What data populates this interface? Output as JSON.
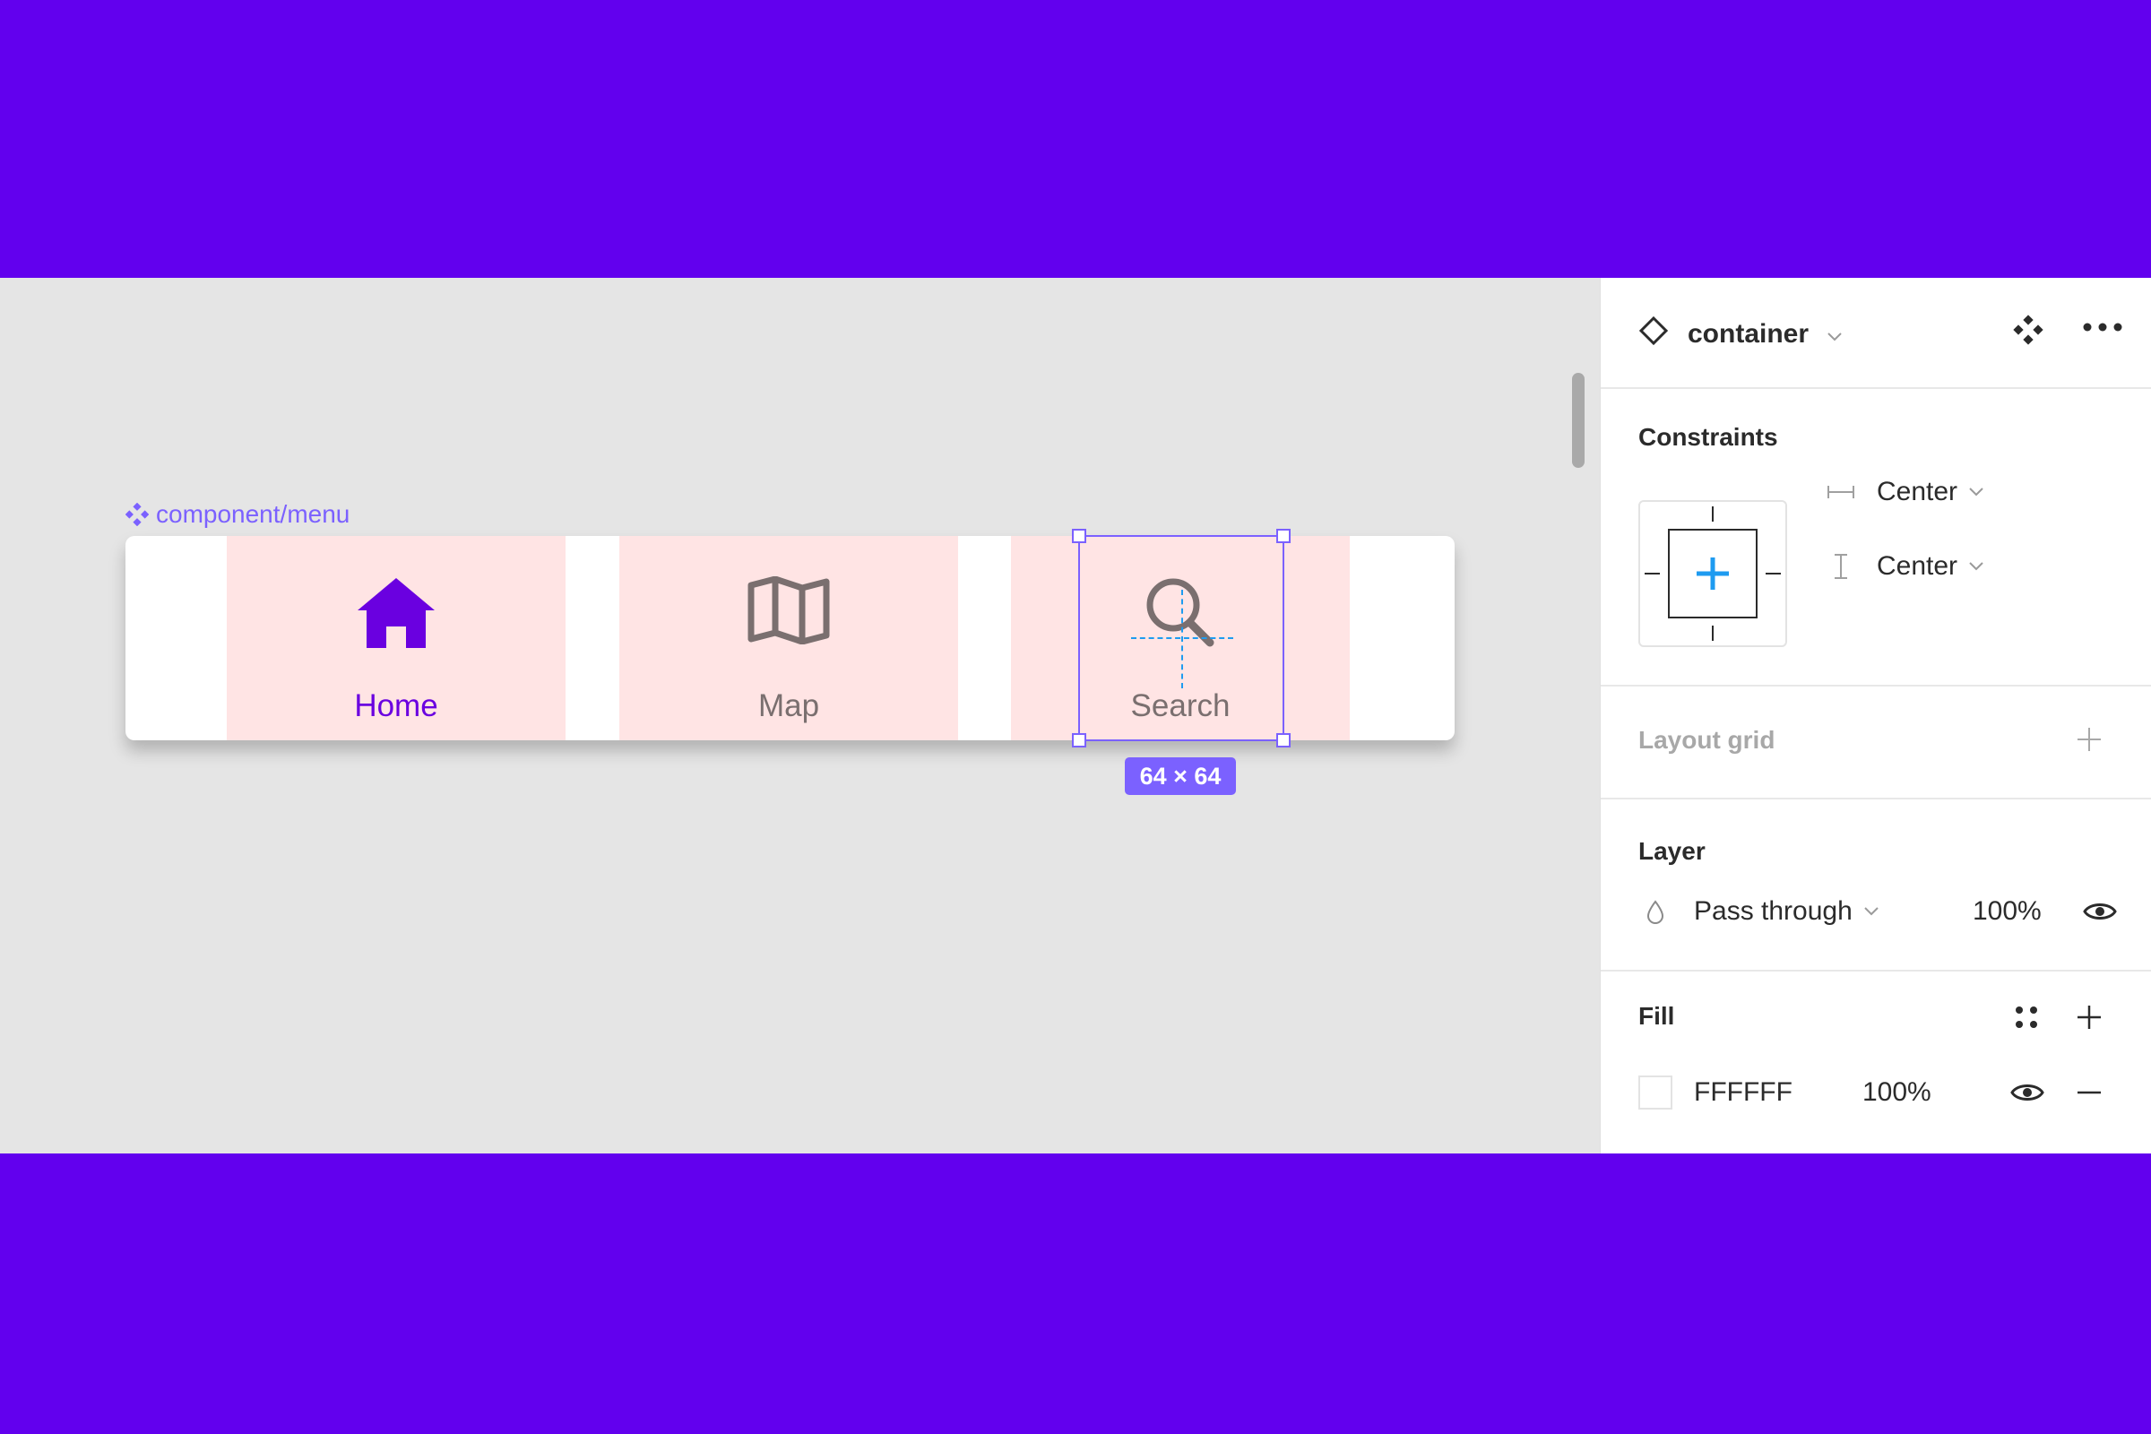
{
  "canvas": {
    "frame_label": "component/menu",
    "menu_items": [
      {
        "label": "Home",
        "icon": "home-icon",
        "active": true
      },
      {
        "label": "Map",
        "icon": "map-icon",
        "active": false
      },
      {
        "label": "Search",
        "icon": "search-icon",
        "active": false
      }
    ],
    "selection_size": "64 × 64",
    "colors": {
      "accent": "#6200EE",
      "selection": "#7B61FF",
      "item_bg": "#FFE4E4",
      "guide": "#1E9BF0"
    }
  },
  "panel": {
    "layer_name": "container",
    "constraints": {
      "title": "Constraints",
      "horizontal": "Center",
      "vertical": "Center"
    },
    "layout_grid": {
      "title": "Layout grid"
    },
    "layer": {
      "title": "Layer",
      "blend_mode": "Pass through",
      "opacity": "100%"
    },
    "fill": {
      "title": "Fill",
      "color_hex": "FFFFFF",
      "opacity": "100%"
    }
  }
}
